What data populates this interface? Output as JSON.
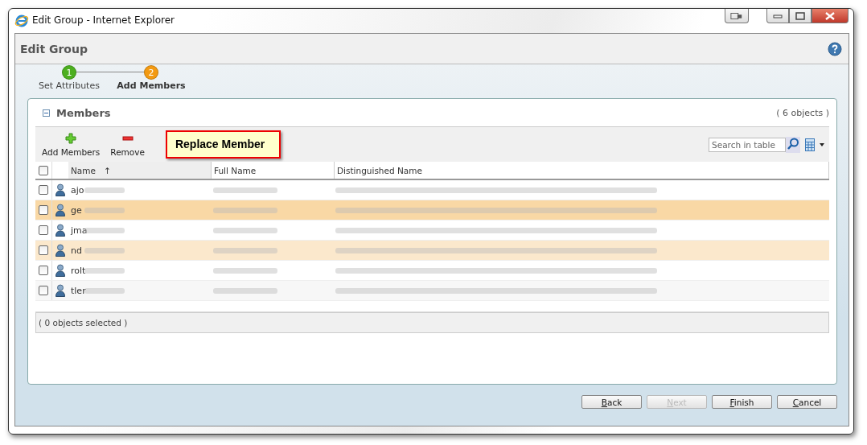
{
  "window": {
    "title": "Edit Group - Internet Explorer"
  },
  "page_title": "Edit Group",
  "steps": [
    {
      "number": "1",
      "label": "Set Attributes",
      "current": false
    },
    {
      "number": "2",
      "label": "Add Members",
      "current": true
    }
  ],
  "panel": {
    "title": "Members",
    "expanded": true,
    "count": "( 6 objects )"
  },
  "toolbar": {
    "buttons": [
      {
        "kind": "add",
        "label": "Add Members"
      },
      {
        "kind": "remove",
        "label": "Remove"
      }
    ],
    "callout": "Replace Member",
    "search": {
      "placeholder": "Search in table"
    }
  },
  "table": {
    "select_all": {
      "checked": false
    },
    "columns": [
      {
        "label": "Name",
        "sorted": true,
        "sort_arrow": "↑"
      },
      {
        "label": "Full Name",
        "sorted": false
      },
      {
        "label": "Distinguished Name",
        "sorted": false
      }
    ],
    "rows": [
      {
        "name": "ajo",
        "checked": false,
        "selected": false,
        "hover": false
      },
      {
        "name": "ge",
        "checked": false,
        "selected": true,
        "hover": false
      },
      {
        "name": "jma",
        "checked": false,
        "selected": false,
        "hover": false
      },
      {
        "name": "nd",
        "checked": false,
        "selected": false,
        "hover": true
      },
      {
        "name": "rolt",
        "checked": false,
        "selected": false,
        "hover": false
      },
      {
        "name": "tler",
        "checked": false,
        "selected": false,
        "hover": false
      }
    ]
  },
  "status": "( 0 objects selected )",
  "buttons": [
    {
      "label": "Back",
      "disabled": false
    },
    {
      "label": "Next",
      "disabled": true
    },
    {
      "label": "Finish",
      "disabled": false
    },
    {
      "label": "Cancel",
      "disabled": false
    }
  ]
}
